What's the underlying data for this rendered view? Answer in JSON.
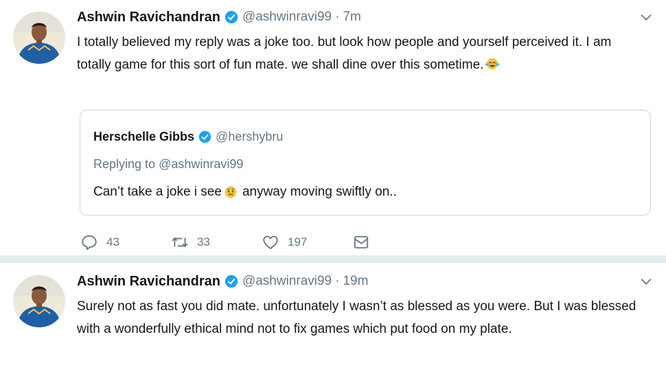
{
  "colors": {
    "verified": "#1da1f2",
    "text": "#14171a",
    "muted": "#657786",
    "border": "#ccd6dd",
    "separator": "#e6ecf0"
  },
  "tweets": [
    {
      "author": "Ashwin Ravichandran",
      "handle": "@ashwinravi99",
      "dot": "·",
      "time": "7m",
      "text_before_emoji": "I totally believed my reply was a joke too. but look how people and yourself perceived it. I am totally game for this sort of fun mate. we shall dine over this sometime.",
      "emoji": "face-with-tears-of-joy",
      "quoted": {
        "author": "Herschelle Gibbs",
        "handle": "@hershybru",
        "replying_prefix": "Replying to",
        "replying_to": "@ashwinravi99",
        "text_before_emoji": "Can’t take a joke i see",
        "emoji": "worried-face",
        "text_after_emoji": "anyway moving swiftly on.."
      },
      "actions": {
        "replies": "43",
        "retweets": "33",
        "likes": "197"
      }
    },
    {
      "author": "Ashwin Ravichandran",
      "handle": "@ashwinravi99",
      "dot": "·",
      "time": "19m",
      "text": "Surely not as fast you did mate. unfortunately I wasn’t as blessed as you were. But I was blessed with a wonderfully ethical mind not to fix games which put food on my plate."
    }
  ]
}
